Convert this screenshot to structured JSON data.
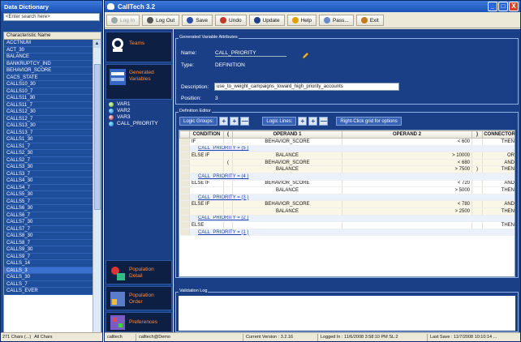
{
  "dictionary": {
    "title": "Data Dictionary",
    "search_placeholder": "<Enter search here>",
    "column_header": "Characteristic Name",
    "items": [
      "ACCTNUM",
      "ACT_30",
      "BALANCE",
      "BANKRUPTCY_IND",
      "BEHAVIOR_SCORE",
      "CACS_STATE",
      "CALLS10_30",
      "CALLS10_7",
      "CALLS11_30",
      "CALLS11_7",
      "CALLS12_30",
      "CALLS12_7",
      "CALLS13_30",
      "CALLS13_7",
      "CALLS1_30",
      "CALLS1_7",
      "CALLS2_30",
      "CALLS2_7",
      "CALLS3_30",
      "CALLS3_7",
      "CALLS4_30",
      "CALLS4_7",
      "CALLS5_30",
      "CALLS5_7",
      "CALLS6_30",
      "CALLS6_7",
      "CALLS7_30",
      "CALLS7_7",
      "CALLS8_30",
      "CALLS8_7",
      "CALLS9_30",
      "CALLS9_7",
      "CALLS_14",
      "CALLS_3",
      "CALLS_30",
      "CALLS_7",
      "CALLS_EVER"
    ],
    "selected_item": "CALLS_3",
    "status_count": "271 Chars (...)",
    "status_filter": "All Chars"
  },
  "window": {
    "title": "CallTech 3.2",
    "minimize": "_",
    "maximize": "□",
    "close": "X"
  },
  "toolbar": {
    "buttons": [
      {
        "label": "Log In",
        "icon": "key-icon",
        "disabled": true,
        "color": "#9aa"
      },
      {
        "label": "Log Out",
        "icon": "key-icon",
        "disabled": false,
        "color": "#555"
      },
      {
        "label": "Save",
        "icon": "disk-icon",
        "disabled": false,
        "color": "#2c4ea8"
      },
      {
        "label": "Undo",
        "icon": "undo-icon",
        "disabled": false,
        "color": "#c0392b"
      },
      {
        "label": "Update",
        "icon": "update-icon",
        "disabled": false,
        "color": "#1d3f87"
      },
      {
        "label": "Help",
        "icon": "help-icon",
        "disabled": false,
        "color": "#e0a000"
      },
      {
        "label": "Pass...",
        "icon": "pass-icon",
        "disabled": false,
        "color": "#6a8acb"
      },
      {
        "label": "Exit",
        "icon": "exit-icon",
        "disabled": false,
        "color": "#c47a1a"
      }
    ]
  },
  "sidebar": {
    "teams": "Teams",
    "generated_variables": "Generated Variables",
    "population_detail": "Population Detail",
    "population_order": "Population Order",
    "preferences": "Preferences",
    "variables": [
      "VAR1",
      "VAR2",
      "VAR3",
      "CALL_PRIORITY"
    ]
  },
  "attributes": {
    "group_title": "Generated Variable Attributes",
    "name_label": "Name:",
    "name_value": "CALL_PRIORITY",
    "type_label": "Type:",
    "type_value": "DEFINITION",
    "description_label": "Description:",
    "description_value": "use_to_weight_campaigns_toward_high_priority_accounts",
    "position_label": "Position:",
    "position_value": "3"
  },
  "definition": {
    "group_title": "Definition Editor",
    "logic_groups_label": "Logic Groups:",
    "logic_lines_label": "Logic Lines:",
    "plus": "+",
    "minus": "—",
    "right_click_hint": "Right-Click grid for options",
    "columns": [
      "CONDITION",
      "(",
      "OPERAND 1",
      "OPERAND 2",
      ")",
      "CONNECTOR"
    ],
    "rows": [
      {
        "type": "cond",
        "cells": [
          "IF",
          "",
          "BEHAVIOR_SCORE",
          "< 600",
          "",
          "THEN"
        ]
      },
      {
        "type": "link",
        "text": "CALL_PRIORITY = (5 )"
      },
      {
        "type": "cond",
        "cells": [
          "ELSE IF",
          "",
          "BALANCE",
          "> 10000",
          "",
          "OR"
        ]
      },
      {
        "type": "cond",
        "cells": [
          "",
          "(",
          "BEHAVIOR_SCORE",
          "< 680",
          "",
          "AND"
        ]
      },
      {
        "type": "cond",
        "cells": [
          "",
          "",
          "BALANCE",
          "> 7500",
          ")",
          "THEN"
        ]
      },
      {
        "type": "link",
        "text": "CALL_PRIORITY = (4 )"
      },
      {
        "type": "cond",
        "cells": [
          "ELSE IF",
          "",
          "BEHAVIOR_SCORE",
          "< 720",
          "",
          "AND"
        ]
      },
      {
        "type": "cond",
        "cells": [
          "",
          "",
          "BALANCE",
          "> 5000",
          "",
          "THEN"
        ]
      },
      {
        "type": "link",
        "text": "CALL_PRIORITY = (3 )"
      },
      {
        "type": "cond",
        "cells": [
          "ELSE IF",
          "",
          "BEHAVIOR_SCORE",
          "< 780",
          "",
          "AND"
        ]
      },
      {
        "type": "cond",
        "cells": [
          "",
          "",
          "BALANCE",
          "> 2500",
          "",
          "THEN"
        ]
      },
      {
        "type": "link",
        "text": "CALL_PRIORITY = (2 )"
      },
      {
        "type": "cond",
        "cells": [
          "ELSE",
          "",
          "",
          "",
          "",
          "THEN"
        ]
      },
      {
        "type": "link",
        "text": "CALL_PRIORITY = (1 )"
      }
    ]
  },
  "validation": {
    "group_title": "Validation Log"
  },
  "status": {
    "db": "calltech",
    "user": "calltech@Demo",
    "version": "Current Version : 3.2.16",
    "logged_in": "Logged In : 11/6/2008 3:58:10 PM  SL:2",
    "last_save": "Last Save : 11/7/2008 10:10:14 ..."
  }
}
